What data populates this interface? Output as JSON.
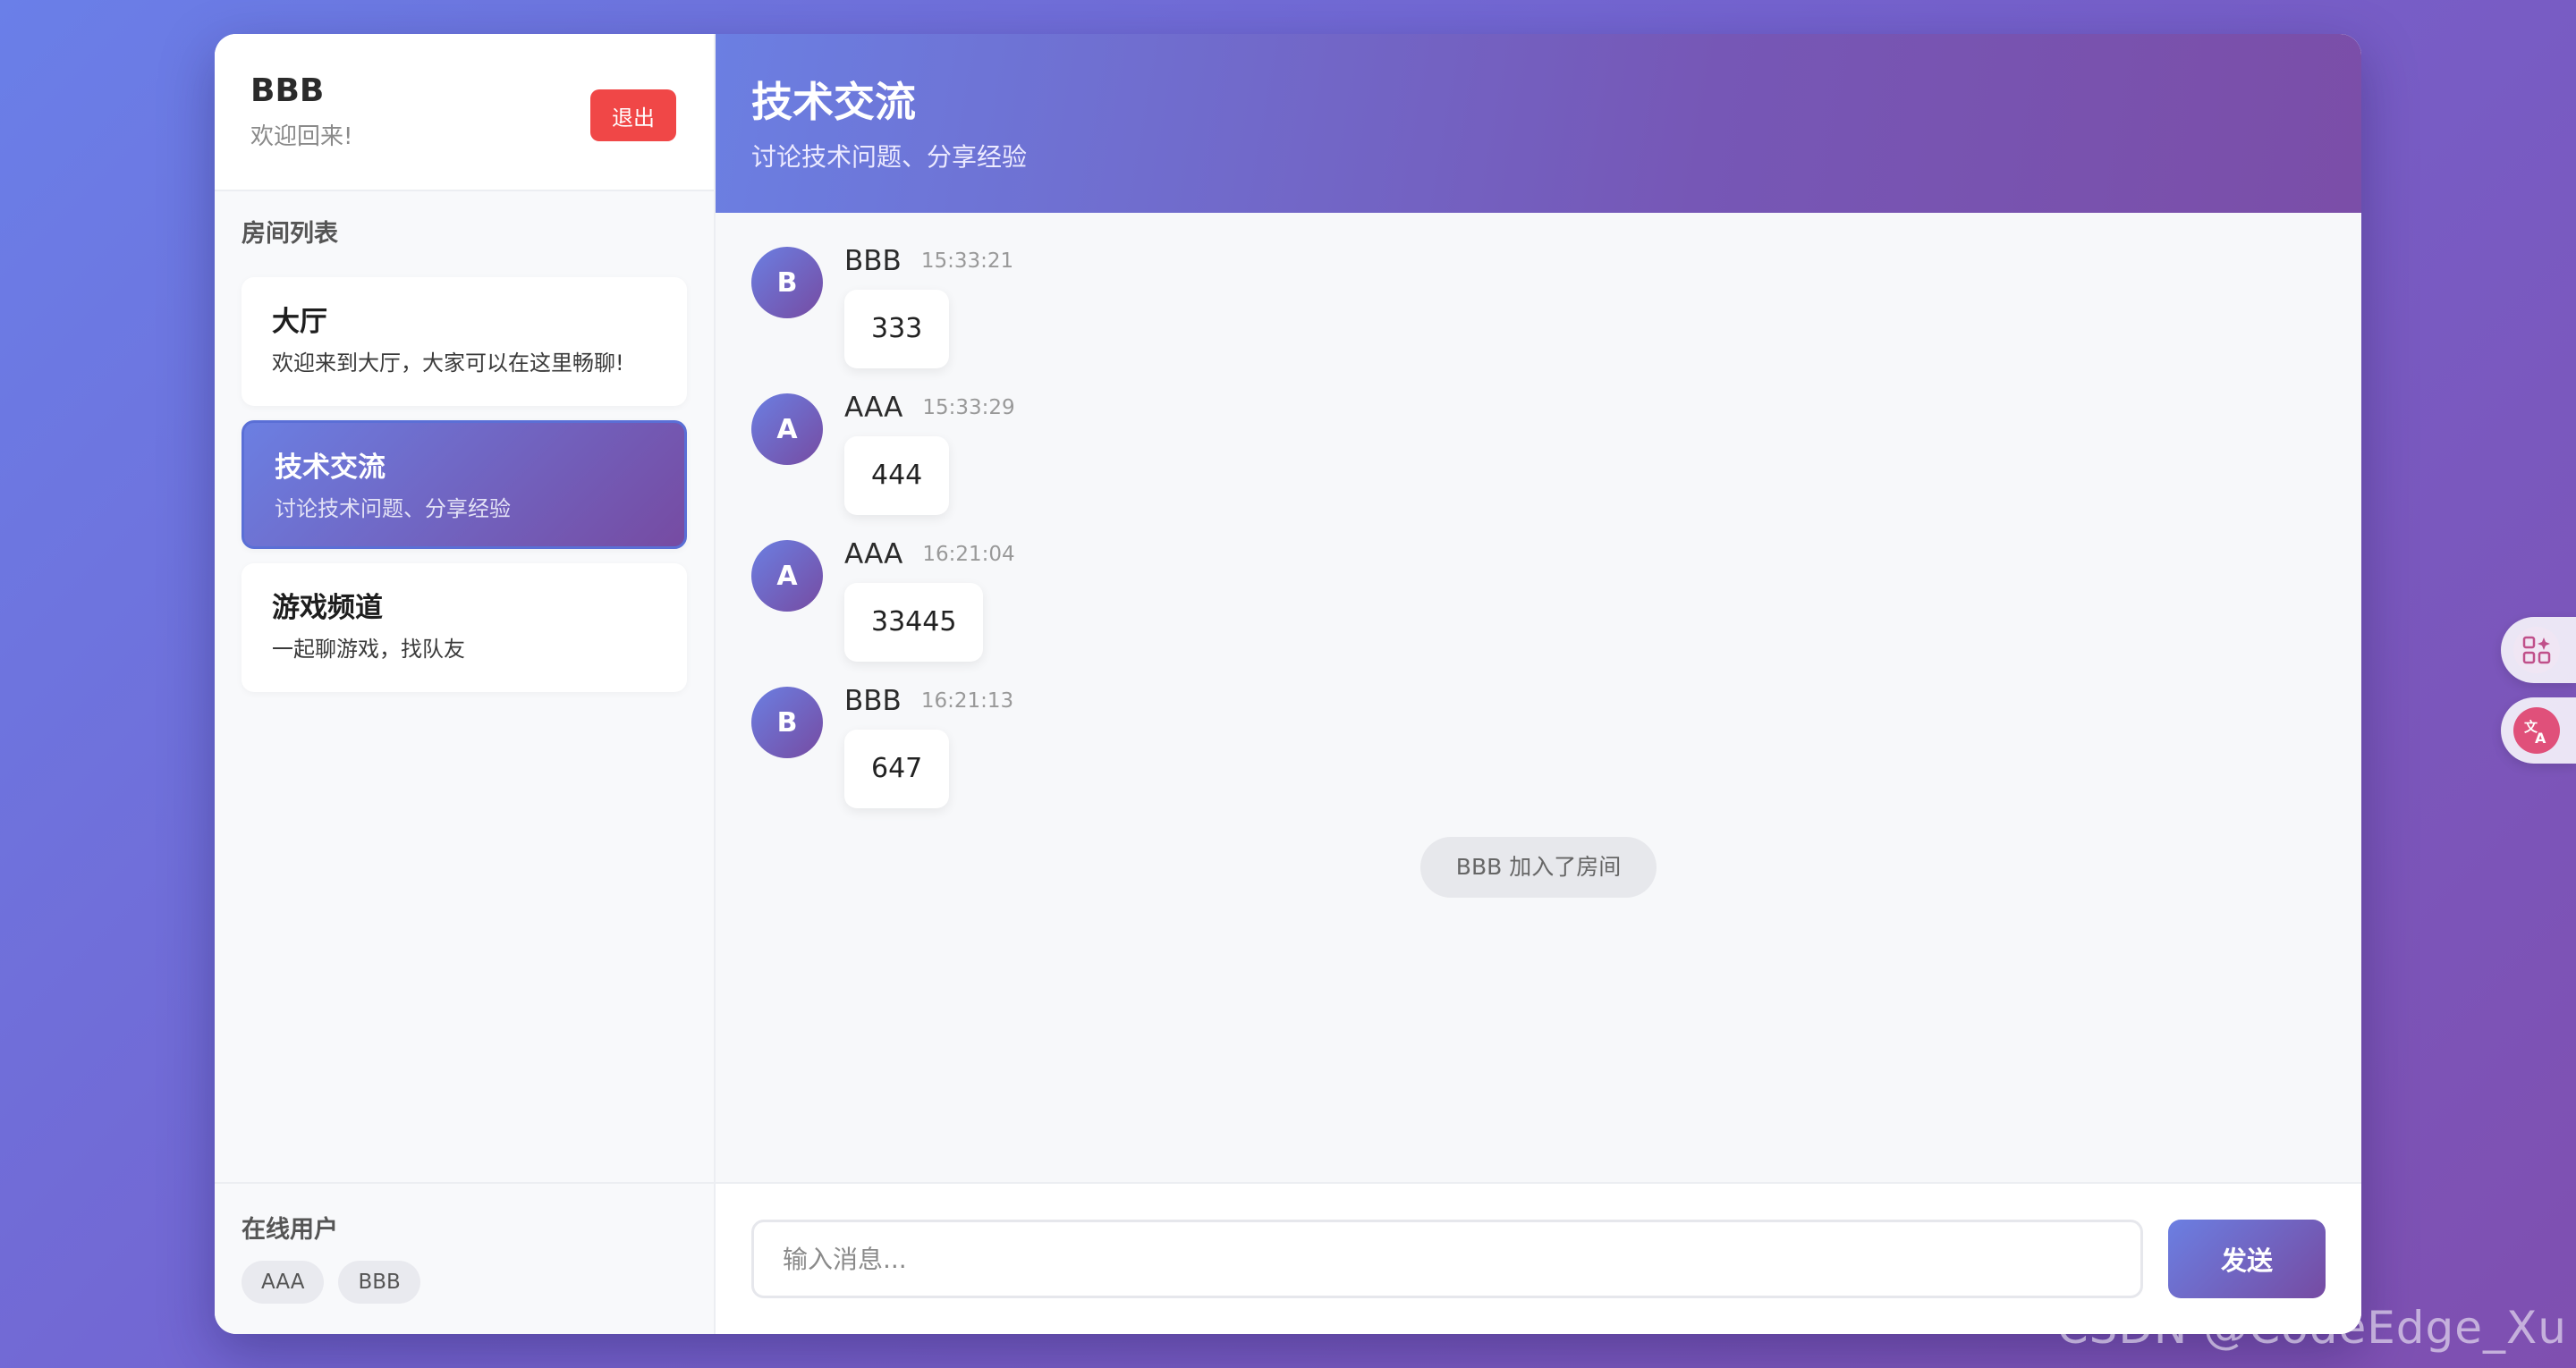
{
  "user": {
    "name": "BBB",
    "welcome": "欢迎回来!",
    "logout_label": "退出"
  },
  "rooms": {
    "title": "房间列表",
    "items": [
      {
        "name": "大厅",
        "desc": "欢迎来到大厅，大家可以在这里畅聊!",
        "active": false
      },
      {
        "name": "技术交流",
        "desc": "讨论技术问题、分享经验",
        "active": true
      },
      {
        "name": "游戏频道",
        "desc": "一起聊游戏，找队友",
        "active": false
      }
    ]
  },
  "online": {
    "title": "在线用户",
    "users": [
      "AAA",
      "BBB"
    ]
  },
  "current_room": {
    "title": "技术交流",
    "subtitle": "讨论技术问题、分享经验"
  },
  "messages": [
    {
      "avatar": "B",
      "user": "BBB",
      "time": "15:33:21",
      "text": "333"
    },
    {
      "avatar": "A",
      "user": "AAA",
      "time": "15:33:29",
      "text": "444"
    },
    {
      "avatar": "A",
      "user": "AAA",
      "time": "16:21:04",
      "text": "33445"
    },
    {
      "avatar": "B",
      "user": "BBB",
      "time": "16:21:13",
      "text": "647"
    }
  ],
  "system_message": "BBB 加入了房间",
  "composer": {
    "placeholder": "输入消息...",
    "value": "",
    "send_label": "发送"
  },
  "side_widgets": [
    {
      "icon": "apps-sparkle-icon"
    },
    {
      "icon": "translate-icon"
    }
  ],
  "watermark": "CSDN @CodeEdge_Xu",
  "colors": {
    "accent_start": "#6b7fe2",
    "accent_end": "#764ba2",
    "logout": "#f04747"
  }
}
